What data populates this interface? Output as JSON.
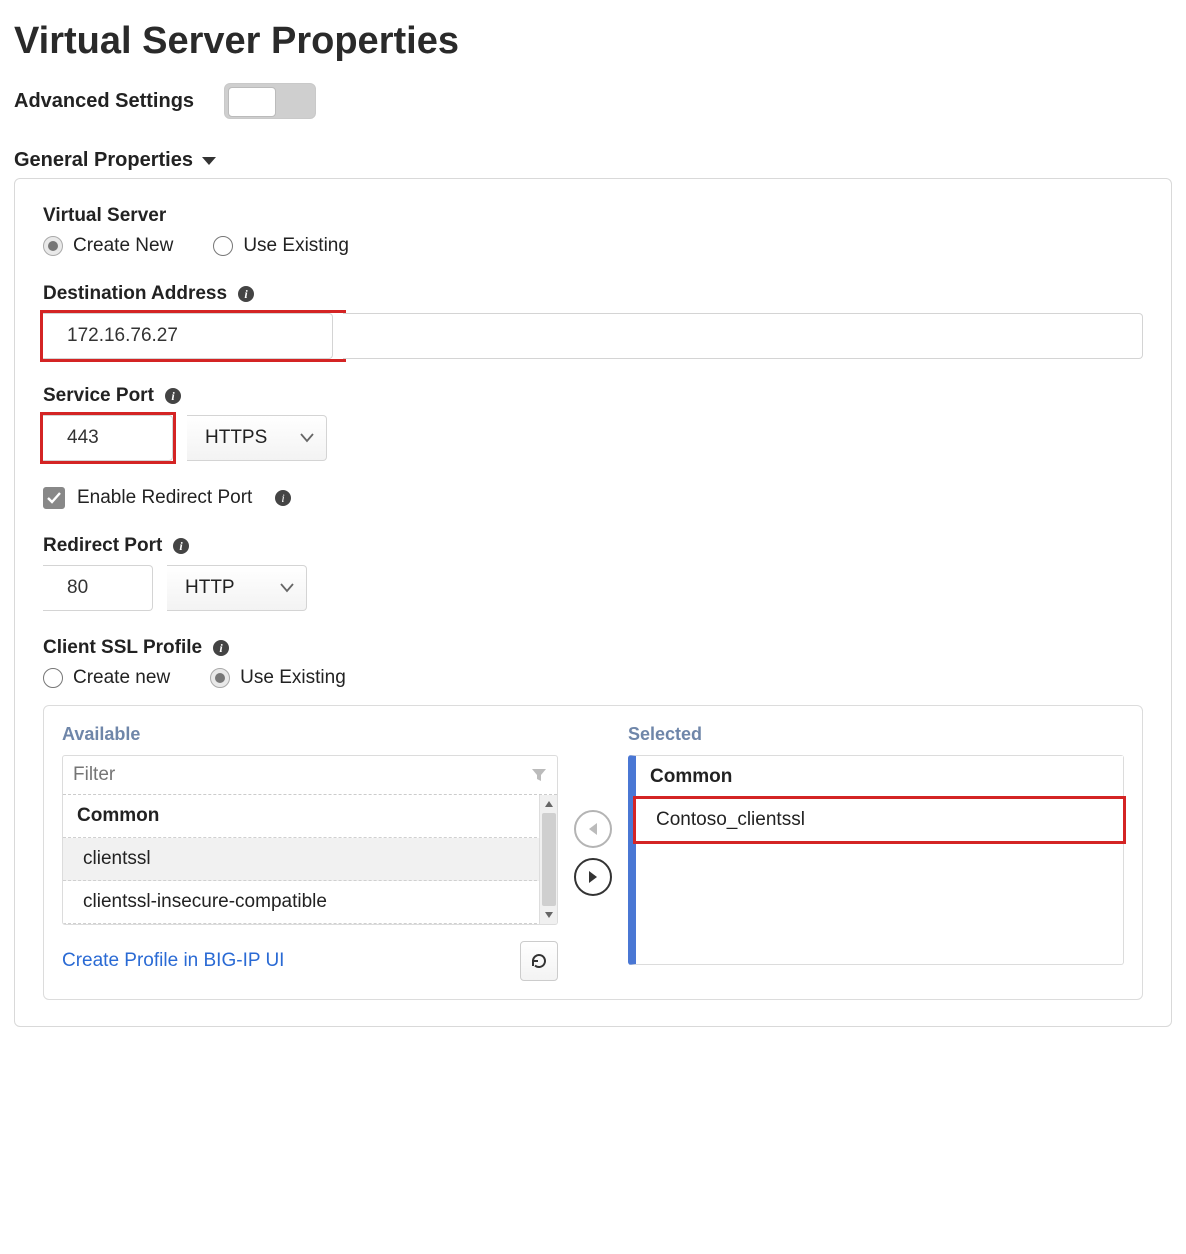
{
  "title": "Virtual Server Properties",
  "advanced_settings_label": "Advanced Settings",
  "section": "General Properties",
  "virtual_server": {
    "label": "Virtual Server",
    "create_new": "Create New",
    "use_existing": "Use Existing"
  },
  "dest": {
    "label": "Destination Address",
    "value": "172.16.76.27"
  },
  "service_port": {
    "label": "Service Port",
    "value": "443",
    "protocol": "HTTPS"
  },
  "redirect_enable": {
    "label": "Enable Redirect Port"
  },
  "redirect_port": {
    "label": "Redirect Port",
    "value": "80",
    "protocol": "HTTP"
  },
  "client_ssl": {
    "label": "Client SSL Profile",
    "create_new": "Create new",
    "use_existing": "Use Existing"
  },
  "dual": {
    "available": "Available",
    "selected": "Selected",
    "filter_placeholder": "Filter",
    "group": "Common",
    "items": {
      "a": "clientssl",
      "b": "clientssl-insecure-compatible"
    },
    "selected_item": "Contoso_clientssl"
  },
  "create_link": "Create Profile in BIG-IP UI"
}
